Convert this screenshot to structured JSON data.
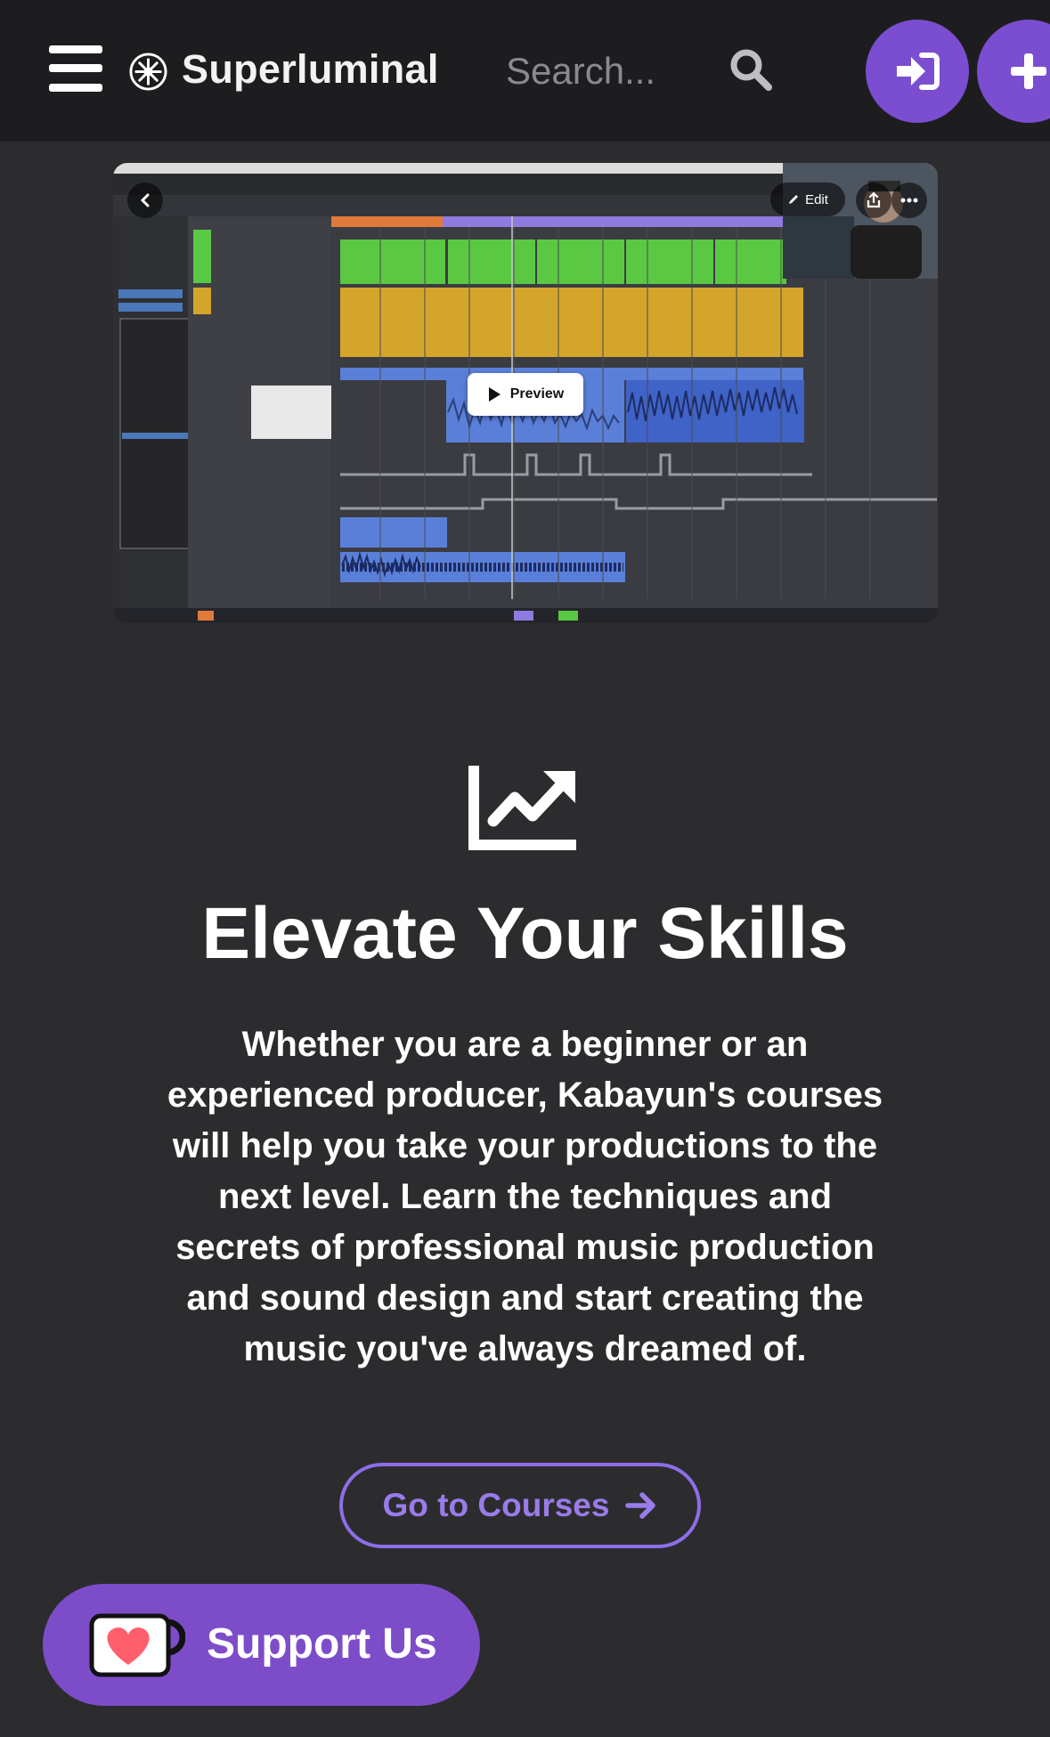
{
  "header": {
    "brand": "Superluminal",
    "search_placeholder": "Search..."
  },
  "video": {
    "preview_label": "Preview",
    "edit_label": "Edit"
  },
  "feature": {
    "title": "Elevate Your Skills",
    "description": "Whether you are a beginner or an experienced producer, Kabayun's courses will help you take your productions to the next level. Learn the techniques and secrets of professional music production and sound design and start creating the music you've always dreamed of.",
    "cta_label": "Go to Courses"
  },
  "support": {
    "label": "Support Us"
  },
  "colors": {
    "accent": "#7a4dd1",
    "cta_border": "#8e6ee8",
    "header_bg": "#1d1d1f",
    "page_bg": "#2c2c2e"
  }
}
